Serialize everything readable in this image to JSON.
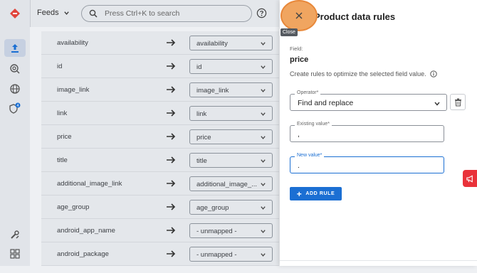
{
  "header": {
    "feeds_label": "Feeds",
    "search_placeholder": "Press Ctrl+K to search"
  },
  "mappings": [
    {
      "source": "availability",
      "target": "availability"
    },
    {
      "source": "id",
      "target": "id"
    },
    {
      "source": "image_link",
      "target": "image_link"
    },
    {
      "source": "link",
      "target": "link"
    },
    {
      "source": "price",
      "target": "price"
    },
    {
      "source": "title",
      "target": "title"
    },
    {
      "source": "additional_image_link",
      "target": "additional_image_..."
    },
    {
      "source": "age_group",
      "target": "age_group"
    },
    {
      "source": "android_app_name",
      "target": "- unmapped -"
    },
    {
      "source": "android_package",
      "target": "- unmapped -"
    }
  ],
  "panel": {
    "title": "Product data rules",
    "close_tooltip": "Close",
    "field_label": "Field:",
    "field_value": "price",
    "description": "Create rules to optimize the selected field value.",
    "operator_label": "Operator*",
    "operator_value": "Find and replace",
    "existing_label": "Existing value*",
    "existing_value": ",",
    "new_label": "New value*",
    "new_value": ".",
    "add_rule_label": "ADD RULE"
  },
  "colors": {
    "primary": "#1b6fd3",
    "close_highlight": "#f0a560",
    "feedback": "#e9323a",
    "brand": "#e0443c"
  }
}
